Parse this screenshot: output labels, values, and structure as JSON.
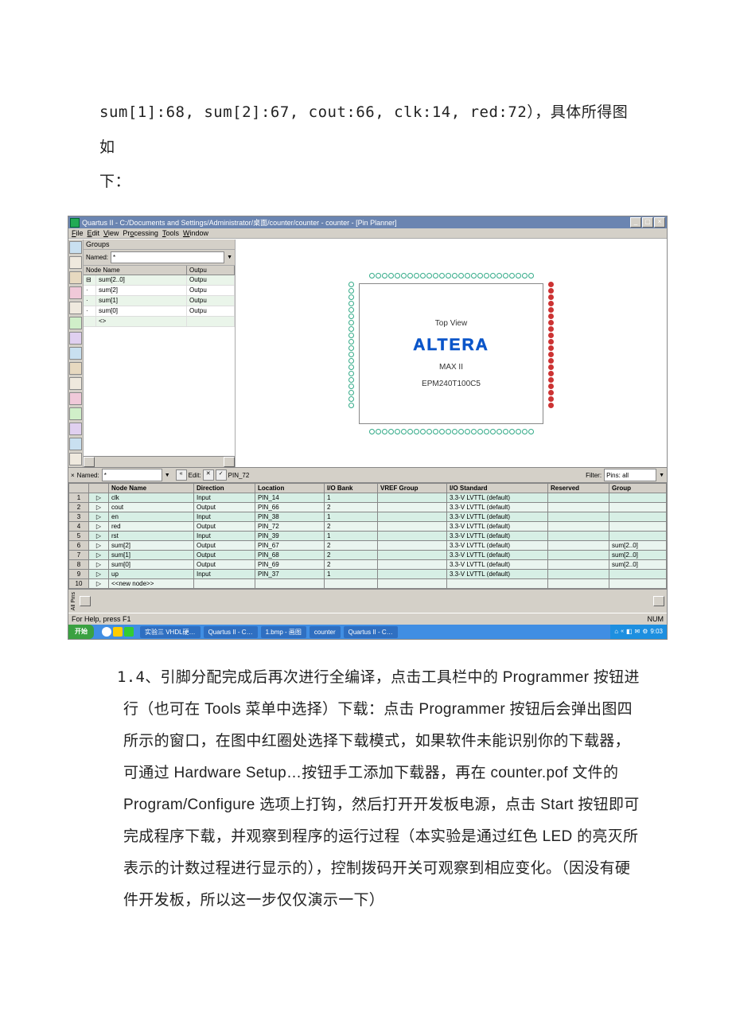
{
  "top_line1": "sum[1]:68, sum[2]:67, cout:66, clk:14, red:72），具体所得图如",
  "top_line2": "下：",
  "app": {
    "title": "Quartus II - C:/Documents and Settings/Administrator/桌面/counter/counter - counter - [Pin Planner]",
    "menus": [
      "File",
      "Edit",
      "View",
      "Processing",
      "Tools",
      "Window"
    ],
    "groups_label": "Groups",
    "named_label": "Named:",
    "group_cols": [
      "Node Name",
      "Outpu"
    ],
    "group_rows": [
      {
        "name": "sum[2..0]",
        "dir": "Outpu"
      },
      {
        "name": "sum[2]",
        "dir": "Outpu"
      },
      {
        "name": "sum[1]",
        "dir": "Outpu"
      },
      {
        "name": "sum[0]",
        "dir": "Outpu"
      },
      {
        "name": "<<new node>>",
        "dir": ""
      }
    ],
    "chip": {
      "top_view": "Top View",
      "logo": "ALTERA",
      "family": "MAX II",
      "part": "EPM240T100C5"
    },
    "bottom_named_label": "Named:",
    "bottom_edit_label": "Edit:",
    "bottom_edit_value": "PIN_72",
    "filter_label": "Filter:",
    "filter_value": "Pins: all",
    "pin_cols": [
      "",
      "",
      "Node Name",
      "Direction",
      "Location",
      "I/O Bank",
      "VREF Group",
      "I/O Standard",
      "Reserved",
      "Group"
    ],
    "pin_rows": [
      {
        "idx": "1",
        "name": "clk",
        "dir": "Input",
        "loc": "PIN_14",
        "bank": "1",
        "vref": "",
        "std": "3.3-V LVTTL (default)",
        "res": "",
        "grp": ""
      },
      {
        "idx": "2",
        "name": "cout",
        "dir": "Output",
        "loc": "PIN_66",
        "bank": "2",
        "vref": "",
        "std": "3.3-V LVTTL (default)",
        "res": "",
        "grp": ""
      },
      {
        "idx": "3",
        "name": "en",
        "dir": "Input",
        "loc": "PIN_38",
        "bank": "1",
        "vref": "",
        "std": "3.3-V LVTTL (default)",
        "res": "",
        "grp": ""
      },
      {
        "idx": "4",
        "name": "red",
        "dir": "Output",
        "loc": "PIN_72",
        "bank": "2",
        "vref": "",
        "std": "3.3-V LVTTL (default)",
        "res": "",
        "grp": ""
      },
      {
        "idx": "5",
        "name": "rst",
        "dir": "Input",
        "loc": "PIN_39",
        "bank": "1",
        "vref": "",
        "std": "3.3-V LVTTL (default)",
        "res": "",
        "grp": ""
      },
      {
        "idx": "6",
        "name": "sum[2]",
        "dir": "Output",
        "loc": "PIN_67",
        "bank": "2",
        "vref": "",
        "std": "3.3-V LVTTL (default)",
        "res": "",
        "grp": "sum[2..0]"
      },
      {
        "idx": "7",
        "name": "sum[1]",
        "dir": "Output",
        "loc": "PIN_68",
        "bank": "2",
        "vref": "",
        "std": "3.3-V LVTTL (default)",
        "res": "",
        "grp": "sum[2..0]"
      },
      {
        "idx": "8",
        "name": "sum[0]",
        "dir": "Output",
        "loc": "PIN_69",
        "bank": "2",
        "vref": "",
        "std": "3.3-V LVTTL (default)",
        "res": "",
        "grp": "sum[2..0]"
      },
      {
        "idx": "9",
        "name": "up",
        "dir": "Input",
        "loc": "PIN_37",
        "bank": "1",
        "vref": "",
        "std": "3.3-V LVTTL (default)",
        "res": "",
        "grp": ""
      },
      {
        "idx": "10",
        "name": "<<new node>>",
        "dir": "",
        "loc": "",
        "bank": "",
        "vref": "",
        "std": "",
        "res": "",
        "grp": ""
      }
    ],
    "side_tab": "All Pins",
    "status_left": "For Help, press F1",
    "status_right": "NUM",
    "start": "开始",
    "taskbar_items": [
      "实验三 VHDL硬…",
      "Quartus II - C…",
      "1.bmp - 画图",
      "counter",
      "Quartus II - C…"
    ],
    "tray_time": "9:03"
  },
  "para_prefix": "1.4、",
  "para_body": "引脚分配完成后再次进行全编译，点击工具栏中的 Programmer 按钮进行（也可在 Tools 菜单中选择）下载：点击 Programmer 按钮后会弹出图四所示的窗口，在图中红圈处选择下载模式，如果软件未能识别你的下载器，可通过 Hardware Setup…按钮手工添加下载器，再在 counter.pof 文件的 Program/Configure 选项上打钩，然后打开开发板电源，点击 Start 按钮即可完成程序下载，并观察到程序的运行过程（本实验是通过红色 LED 的亮灭所表示的计数过程进行显示的），控制拨码开关可观察到相应变化。（因没有硬件开发板，所以这一步仅仅演示一下）"
}
